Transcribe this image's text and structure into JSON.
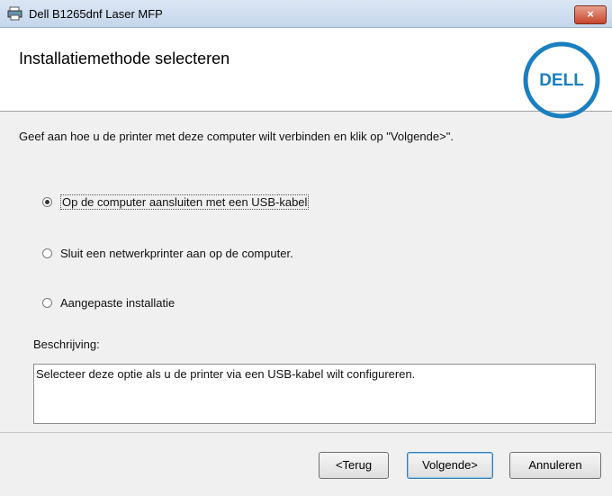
{
  "window": {
    "title": "Dell B1265dnf Laser MFP",
    "close_label": "×"
  },
  "header": {
    "title": "Installatiemethode selecteren",
    "logo_text": "DELL",
    "logo_color": "#1a7fc1"
  },
  "content": {
    "instruction": "Geef aan hoe u de printer met deze computer wilt verbinden en klik op \"Volgende>\".",
    "options": [
      {
        "label": "Op de computer aansluiten met een USB-kabel",
        "selected": true
      },
      {
        "label": "Sluit een netwerkprinter aan op de computer.",
        "selected": false
      },
      {
        "label": "Aangepaste installatie",
        "selected": false
      }
    ],
    "description_label": "Beschrijving:",
    "description_text": "Selecteer deze optie als u de printer via een USB-kabel wilt configureren."
  },
  "footer": {
    "back_label": "<Terug",
    "next_label": "Volgende>",
    "cancel_label": "Annuleren"
  }
}
